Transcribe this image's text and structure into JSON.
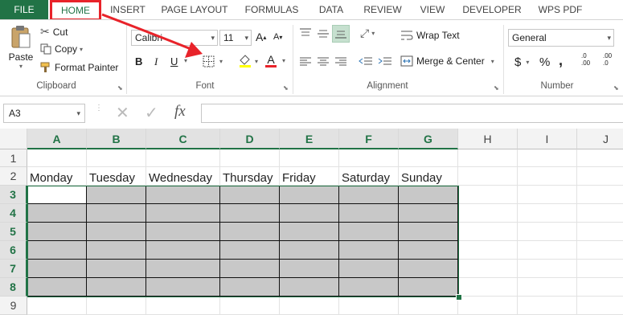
{
  "tabs": [
    {
      "label": "FILE"
    },
    {
      "label": "HOME"
    },
    {
      "label": "INSERT"
    },
    {
      "label": "PAGE LAYOUT"
    },
    {
      "label": "FORMULAS"
    },
    {
      "label": "DATA"
    },
    {
      "label": "REVIEW"
    },
    {
      "label": "VIEW"
    },
    {
      "label": "DEVELOPER"
    },
    {
      "label": "WPS PDF"
    }
  ],
  "clipboard": {
    "paste_label": "Paste",
    "cut_label": "Cut",
    "copy_label": "Copy",
    "format_painter_label": "Format Painter",
    "group_label": "Clipboard"
  },
  "font": {
    "font_name": "Calibri",
    "font_size": "11",
    "bold": "B",
    "italic": "I",
    "underline": "U",
    "grow": "A",
    "shrink": "A",
    "font_color_letter": "A",
    "group_label": "Font"
  },
  "alignment": {
    "wrap_text_label": "Wrap Text",
    "merge_center_label": "Merge & Center",
    "group_label": "Alignment"
  },
  "number": {
    "format_value": "General",
    "currency": "$",
    "percent": "%",
    "comma": ",",
    "inc_decimal_top": ".0",
    "inc_decimal_bottom": ".00",
    "dec_decimal_top": ".00",
    "dec_decimal_bottom": ".0",
    "group_label": "Number"
  },
  "formula_bar": {
    "name_box": "A3",
    "fx": "fx",
    "formula_value": ""
  },
  "sheet": {
    "columns": [
      "A",
      "B",
      "C",
      "D",
      "E",
      "F",
      "G",
      "H",
      "I",
      "J"
    ],
    "rows": [
      "1",
      "2",
      "3",
      "4",
      "5",
      "6",
      "7",
      "8",
      "9"
    ],
    "row2_values": [
      "Monday",
      "Tuesday",
      "Wednesday",
      "Thursday",
      "Friday",
      "Saturday",
      "Sunday"
    ],
    "active_cell": "A3"
  },
  "colors": {
    "accent": "#217346",
    "annotation": "#e8232a",
    "shaded_fill": "#c8c8c8",
    "font_color_bar": "#e8232a",
    "fill_color_bar": "#ffff00"
  }
}
